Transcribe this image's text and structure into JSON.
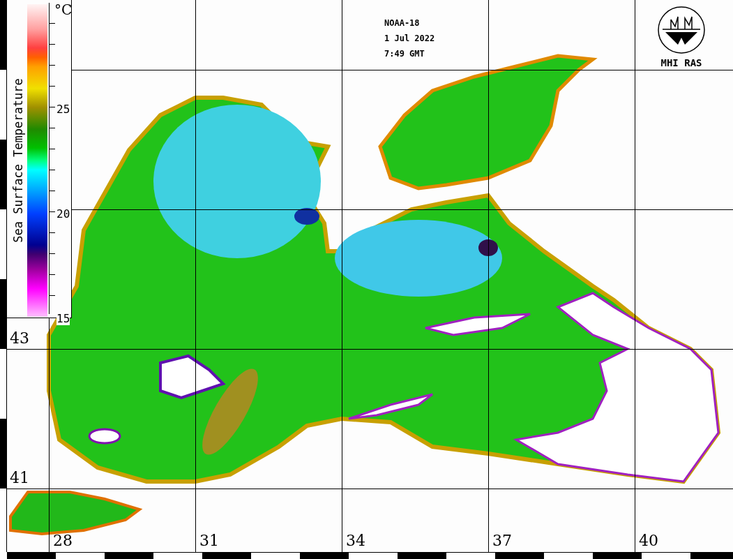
{
  "legend": {
    "title": "Sea Surface Temperature",
    "unit": "°C",
    "ticks": [
      "25",
      "20",
      "15"
    ]
  },
  "caption": {
    "satellite": "NOAA-18",
    "date": "1 Jul 2022",
    "time": "7:49 GMT"
  },
  "logo": {
    "label": "MHI RAS"
  },
  "grid": {
    "latitudes": [
      "43",
      "41"
    ],
    "longitudes": [
      "28",
      "31",
      "34",
      "37",
      "40"
    ]
  }
}
